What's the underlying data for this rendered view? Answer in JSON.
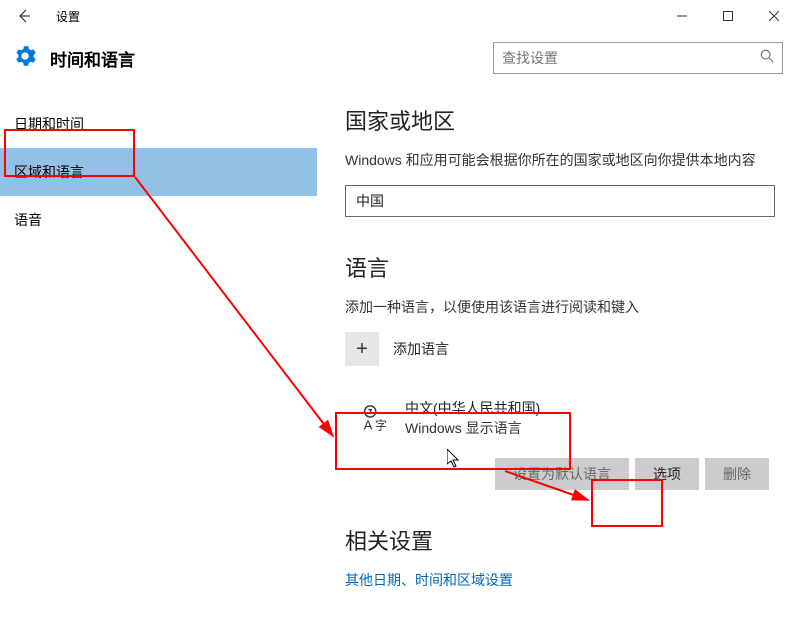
{
  "titlebar": {
    "title": "设置"
  },
  "header": {
    "title": "时间和语言",
    "search_placeholder": "查找设置"
  },
  "sidebar": {
    "items": [
      {
        "label": "日期和时间"
      },
      {
        "label": "区域和语言"
      },
      {
        "label": "语音"
      }
    ]
  },
  "region": {
    "title": "国家或地区",
    "desc": "Windows 和应用可能会根据你所在的国家或地区向你提供本地内容",
    "selected": "中国"
  },
  "language": {
    "title": "语言",
    "desc": "添加一种语言，以便使用该语言进行阅读和键入",
    "add_label": "添加语言",
    "card": {
      "name": "中文(中华人民共和国)",
      "sub": "Windows 显示语言"
    },
    "buttons": {
      "set_default": "设置为默认语言",
      "options": "选项",
      "remove": "删除"
    }
  },
  "related": {
    "title": "相关设置",
    "link": "其他日期、时间和区域设置"
  },
  "annotations": {
    "highlight_color": "#ff0000"
  }
}
